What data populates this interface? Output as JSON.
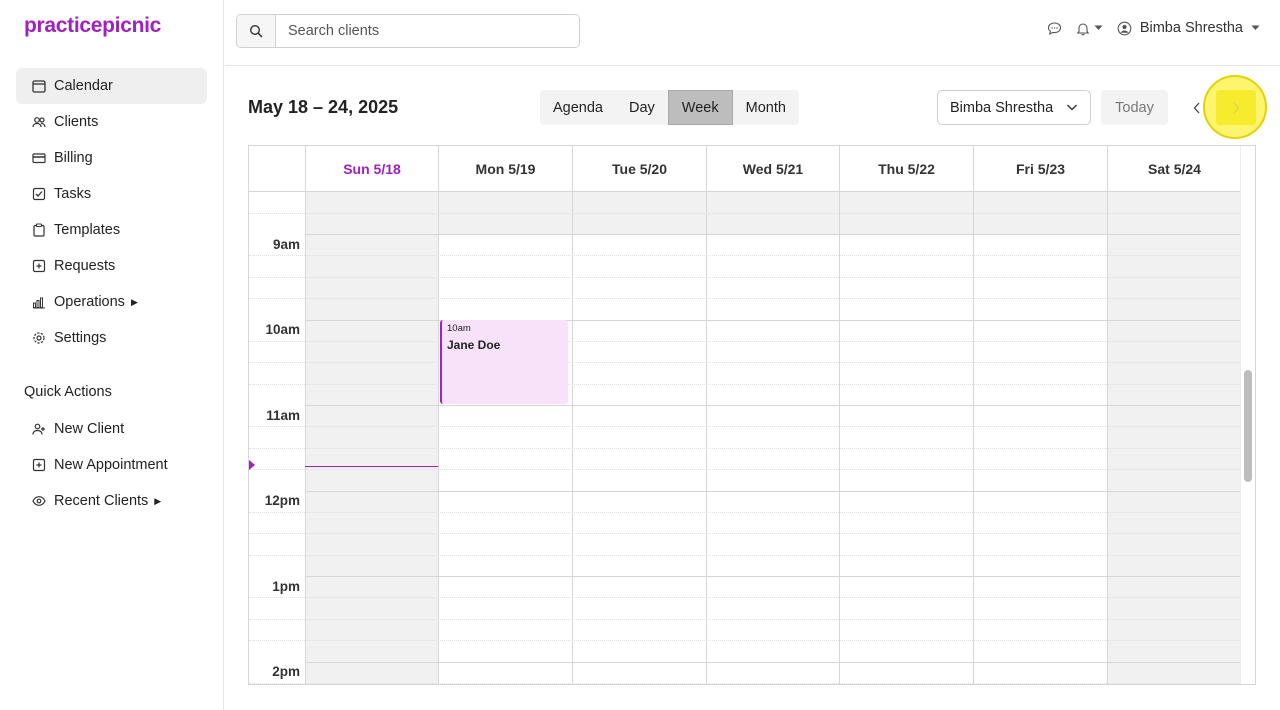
{
  "app": {
    "logo": "practicepicnic"
  },
  "sidebar": {
    "items": [
      {
        "label": "Calendar",
        "icon": "calendar-icon",
        "active": true
      },
      {
        "label": "Clients",
        "icon": "users-icon"
      },
      {
        "label": "Billing",
        "icon": "credit-card-icon"
      },
      {
        "label": "Tasks",
        "icon": "checkbox-icon"
      },
      {
        "label": "Templates",
        "icon": "clipboard-icon"
      },
      {
        "label": "Requests",
        "icon": "plus-square-icon"
      },
      {
        "label": "Operations",
        "icon": "bar-chart-icon",
        "has_submenu": true
      },
      {
        "label": "Settings",
        "icon": "gear-icon"
      }
    ],
    "quick_actions_title": "Quick Actions",
    "quick_actions": [
      {
        "label": "New Client",
        "icon": "add-user-icon"
      },
      {
        "label": "New Appointment",
        "icon": "plus-square-icon"
      },
      {
        "label": "Recent Clients",
        "icon": "eye-icon",
        "has_submenu": true
      }
    ]
  },
  "topbar": {
    "search_placeholder": "Search clients",
    "user_name": "Bimba Shrestha"
  },
  "toolbar": {
    "range_title": "May 18 – 24, 2025",
    "views": [
      "Agenda",
      "Day",
      "Week",
      "Month"
    ],
    "active_view": "Week",
    "staff_selected": "Bimba Shrestha",
    "today_label": "Today"
  },
  "calendar": {
    "days": [
      "Sun 5/18",
      "Mon 5/19",
      "Tue 5/20",
      "Wed 5/21",
      "Thu 5/22",
      "Fri 5/23",
      "Sat 5/24"
    ],
    "today_index": 0,
    "time_labels": [
      "9am",
      "10am",
      "11am",
      "12pm",
      "1pm",
      "2pm"
    ],
    "events": [
      {
        "day": "Mon 5/19",
        "time": "10am",
        "title": "Jane Doe"
      }
    ]
  },
  "colors": {
    "brand": "#a020c0",
    "event_bg": "#f8e2fa",
    "active_view_bg": "#bdbdbd",
    "highlight": "#f5ea3a"
  }
}
